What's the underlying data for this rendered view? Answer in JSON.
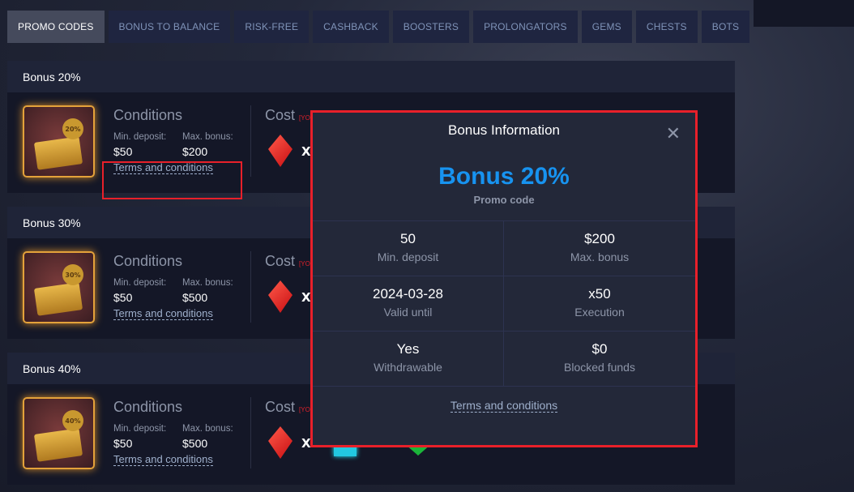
{
  "tabs": [
    {
      "label": "PROMO CODES",
      "active": true
    },
    {
      "label": "BONUS TO BALANCE"
    },
    {
      "label": "RISK-FREE"
    },
    {
      "label": "CASHBACK"
    },
    {
      "label": "BOOSTERS"
    },
    {
      "label": "PROLONGATORS"
    },
    {
      "label": "GEMS"
    },
    {
      "label": "CHESTS"
    },
    {
      "label": "BOTS"
    }
  ],
  "cards": [
    {
      "title": "Bonus 20%",
      "badge": "20%",
      "conditions": "Conditions",
      "min_label": "Min. deposit:",
      "min": "$50",
      "max_label": "Max. bonus:",
      "max": "$200",
      "terms": "Terms and conditions",
      "cost": "Cost",
      "cost_note": "[YO",
      "x": "X"
    },
    {
      "title": "Bonus 30%",
      "badge": "30%",
      "conditions": "Conditions",
      "min_label": "Min. deposit:",
      "min": "$50",
      "max_label": "Max. bonus:",
      "max": "$500",
      "terms": "Terms and conditions",
      "cost": "Cost",
      "cost_note": "[YO",
      "x": "X"
    },
    {
      "title": "Bonus 40%",
      "badge": "40%",
      "conditions": "Conditions",
      "min_label": "Min. deposit:",
      "min": "$50",
      "max_label": "Max. bonus:",
      "max": "$500",
      "terms": "Terms and conditions",
      "cost": "Cost",
      "cost_note": "[YO",
      "x": "X"
    }
  ],
  "modal": {
    "title": "Bonus Information",
    "bonus": "Bonus 20%",
    "subtitle": "Promo code",
    "cells": [
      {
        "value": "50",
        "label": "Min. deposit"
      },
      {
        "value": "$200",
        "label": "Max. bonus"
      },
      {
        "value": "2024-03-28",
        "label": "Valid until"
      },
      {
        "value": "x50",
        "label": "Execution"
      },
      {
        "value": "Yes",
        "label": "Withdrawable"
      },
      {
        "value": "$0",
        "label": "Blocked funds"
      }
    ],
    "terms": "Terms and conditions"
  },
  "colors": {
    "accent": "#1793f0",
    "highlight": "#e8202a"
  }
}
